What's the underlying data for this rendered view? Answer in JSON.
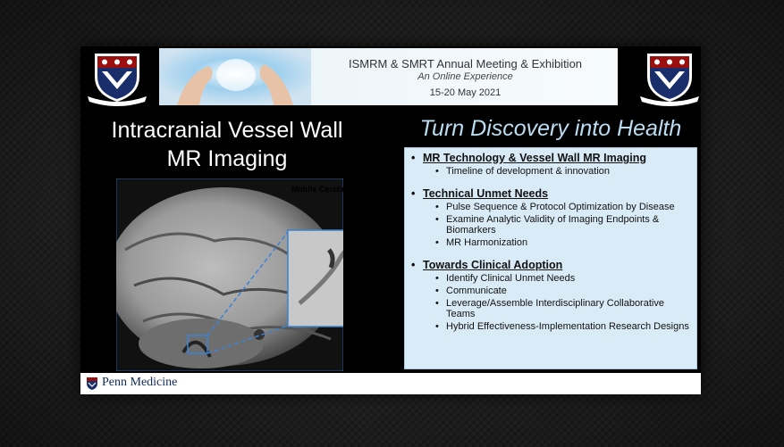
{
  "banner": {
    "line1": "ISMRM & SMRT Annual Meeting & Exhibition",
    "line2": "An Online Experience",
    "line3": "15-20 May 2021"
  },
  "title": {
    "line1": "Intracranial Vessel Wall",
    "line2": "MR Imaging"
  },
  "tagline": "Turn Discovery into Health",
  "image": {
    "inset_label": "Middle Cerebral Artery"
  },
  "sections": [
    {
      "heading": "MR Technology & Vessel Wall MR Imaging",
      "items": [
        "Timeline of development & innovation"
      ]
    },
    {
      "heading": "Technical Unmet Needs",
      "items": [
        "Pulse Sequence & Protocol Optimization by Disease",
        "Examine Analytic Validity of Imaging Endpoints & Biomarkers",
        "MR Harmonization"
      ]
    },
    {
      "heading": "Towards Clinical Adoption",
      "items": [
        "Identify Clinical Unmet Needs",
        "Communicate",
        "Leverage/Assemble Interdisciplinary Collaborative Teams",
        "Hybrid Effectiveness-Implementation Research Designs"
      ]
    }
  ],
  "footer": {
    "logo_text": "Penn Medicine"
  },
  "colors": {
    "slide_bg": "#000000",
    "panel_bg": "#d9ebf6",
    "tagline": "#bcdcf2",
    "penn_blue": "#0e2a5c",
    "penn_red": "#990000"
  }
}
